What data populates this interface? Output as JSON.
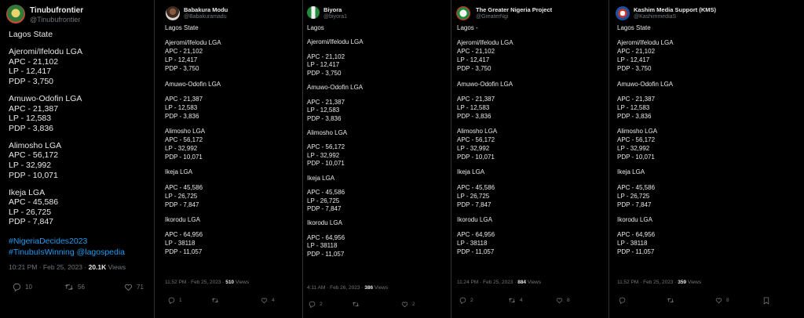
{
  "tweets": [
    {
      "name": "Tinubufrontier",
      "handle": "@Tinubufrontier",
      "lines": [
        "Lagos State",
        "",
        "Ajeromi/Ifelodu LGA",
        "APC - 21,102",
        "LP - 12,417",
        "PDP - 3,750",
        "",
        "Amuwo-Odofin LGA",
        "APC - 21,387",
        "LP - 12,583",
        "PDP - 3,836",
        "",
        "Alimosho LGA",
        "APC - 56,172",
        "LP - 32,992",
        "PDP - 10,071",
        "",
        "Ikeja LGA",
        "APC - 45,586",
        "LP - 26,725",
        "PDP - 7,847"
      ],
      "hashtags": [
        "#NigeriaDecides2023",
        "#TinubuIsWinning @lagospedia"
      ],
      "time": "10:21 PM · Feb 25, 2023 · ",
      "views_count": "20.1K",
      "views_label": " Views",
      "replies": "10",
      "retweets": "56",
      "likes": "71"
    },
    {
      "name": "Babakura Modu",
      "handle": "@Babakuramadu",
      "lines": [
        "Lagos State",
        "",
        "Ajeromi/Ifelodu LGA",
        "APC - 21,102",
        "LP - 12,417",
        "PDP - 3,750",
        "",
        "Amuwo-Odofin LGA",
        "",
        "APC - 21,387",
        "LP - 12,583",
        "PDP - 3,836",
        "",
        "Alimosho LGA",
        "APC - 56,172",
        "LP - 32,992",
        "PDP - 10,071",
        "",
        "Ikeja LGA",
        "",
        "APC - 45,586",
        "LP - 26,725",
        "PDP - 7,847",
        "",
        "Ikorodu LGA",
        "",
        "APC - 64,956",
        "LP - 38118",
        "PDP - 11,057"
      ],
      "time": "11:52 PM · Feb 25, 2023 · ",
      "views_count": "510",
      "views_label": " Views",
      "replies": "1",
      "retweets": "",
      "likes": "4"
    },
    {
      "name": "Biyora",
      "handle": "@biyora1",
      "lines": [
        "Lagos",
        "",
        "Ajeromi/Ifelodu LGA",
        "",
        "APC - 21,102",
        "LP - 12,417",
        "PDP - 3,750",
        "",
        "Amuwo-Odofin LGA",
        "",
        "APC - 21,387",
        "LP - 12,583",
        "PDP - 3,836",
        "",
        "Alimosho LGA",
        "",
        "APC - 56,172",
        "LP - 32,992",
        "PDP - 10,071",
        "",
        "Ikeja LGA",
        "",
        "APC - 45,586",
        "LP - 26,725",
        "PDP - 7,847",
        "",
        "Ikorodu LGA",
        "",
        "APC - 64,956",
        "LP - 38118",
        "PDP - 11,057"
      ],
      "time": "4:11 AM · Feb 26, 2023 · ",
      "views_count": "386",
      "views_label": " Views",
      "replies": "2",
      "retweets": "",
      "likes": "2"
    },
    {
      "name": "The Greater Nigeria Project",
      "handle": "@GreaterNgi",
      "lines": [
        "Lagos -",
        "",
        "Ajeromi/Ifelodu LGA",
        "APC - 21,102",
        "LP - 12,417",
        "PDP - 3,750",
        "",
        "Amuwo-Odofin LGA",
        "",
        "APC - 21,387",
        "LP - 12,583",
        "PDP - 3,836",
        "",
        "Alimosho LGA",
        "APC - 56,172",
        "LP - 32,992",
        "PDP - 10,071",
        "",
        "Ikeja LGA",
        "",
        "APC - 45,586",
        "LP - 26,725",
        "PDP - 7,847",
        "",
        "Ikorodu LGA",
        "",
        "APC - 64,956",
        "LP - 38118",
        "PDP - 11,057"
      ],
      "time": "11:24 PM · Feb 25, 2023 · ",
      "views_count": "884",
      "views_label": " Views",
      "replies": "2",
      "retweets": "4",
      "likes": "8"
    },
    {
      "name": "Kashim Media Support (KMS)",
      "handle": "@KashimmediaS",
      "lines": [
        "Lagos State",
        "",
        "Ajeromi/Ifelodu LGA",
        "APC - 21,102",
        "LP - 12,417",
        "PDP - 3,750",
        "",
        "Amuwo-Odofin LGA",
        "",
        "APC - 21,387",
        "LP - 12,583",
        "PDP - 3,836",
        "",
        "Alimosho LGA",
        "APC - 56,172",
        "LP - 32,992",
        "PDP - 10,071",
        "",
        "Ikeja LGA",
        "",
        "APC - 45,586",
        "LP - 26,725",
        "PDP - 7,847",
        "",
        "Ikorodu LGA",
        "",
        "APC - 64,956",
        "LP - 38118",
        "PDP - 11,057"
      ],
      "time": "11:52 PM · Feb 25, 2023 · ",
      "views_count": "359",
      "views_label": " Views",
      "replies": "",
      "retweets": "",
      "likes": "8"
    }
  ],
  "colors": {
    "background": "#000000",
    "text": "#e7e9ea",
    "muted": "#71767b",
    "link": "#1d9bf0",
    "divider": "#2f3336"
  },
  "icons": [
    "reply-icon",
    "retweet-icon",
    "like-icon",
    "bookmark-icon"
  ]
}
